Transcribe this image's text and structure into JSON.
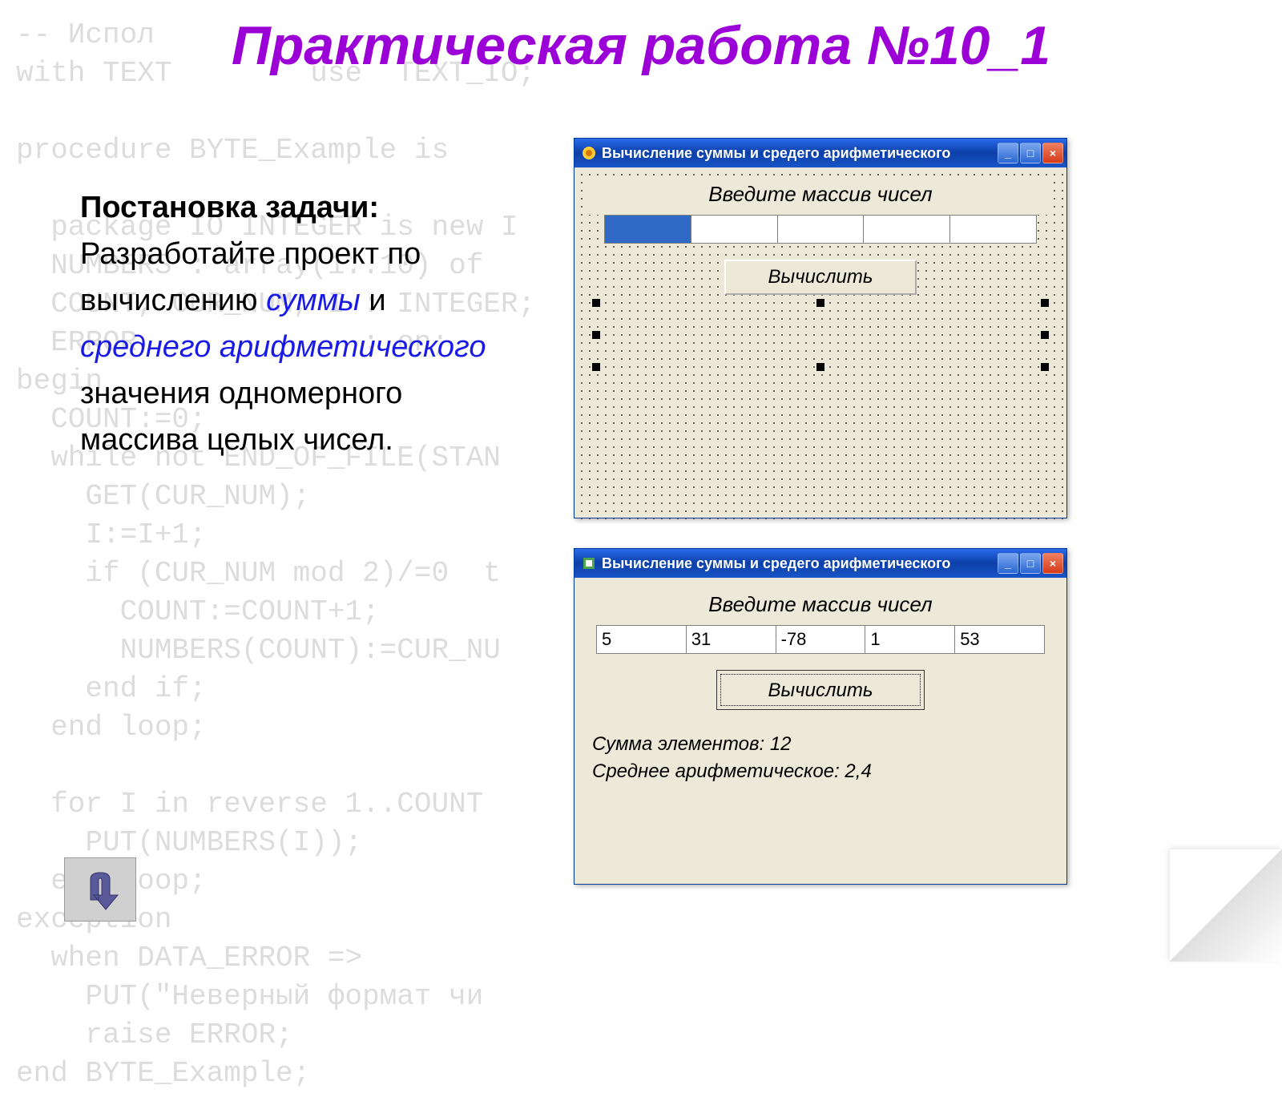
{
  "slide": {
    "title": "Практическая работа №10_1"
  },
  "task": {
    "heading": "Постановка задачи:",
    "line1": "Разработайте проект по вычислению ",
    "em1": "суммы",
    "and": " и ",
    "em2": "среднего арифметического",
    "line2": " значения одномерного массива целых чисел."
  },
  "bg_code": "-- Испол\nwith TEXT        use  TEXT_IO;\n\nprocedure BYTE_Example is\n\n  package IO INTEGER is new I\n  NUMBERS : array(1..10) of\n  COUNT, CUR_NUM, I : INTEGER;\n  ERROR             : on;\nbegin\n  COUNT:=0;\n  while not END_OF_FILE(STAN\n    GET(CUR_NUM);\n    I:=I+1;\n    if (CUR_NUM mod 2)/=0  t\n      COUNT:=COUNT+1;\n      NUMBERS(COUNT):=CUR_NU\n    end if;\n  end loop;\n\n  for I in reverse 1..COUNT\n    PUT(NUMBERS(I));\n  end loop;\nexception\n  when DATA_ERROR =>\n    PUT(\"Неверный формат чи\n    raise ERROR;\nend BYTE_Example;",
  "window_design": {
    "title": "Вычисление суммы и средего арифметического",
    "prompt": "Введите массив чисел",
    "button": "Вычислить",
    "cells": [
      "",
      "",
      "",
      "",
      ""
    ]
  },
  "window_run": {
    "title": "Вычисление суммы и средего арифметического",
    "prompt": "Введите массив чисел",
    "button": "Вычислить",
    "cells": [
      "5",
      "31",
      "-78",
      "1",
      "53"
    ],
    "result_line1": "Сумма элементов: 12",
    "result_line2": "Среднее арифметическое: 2,4"
  }
}
